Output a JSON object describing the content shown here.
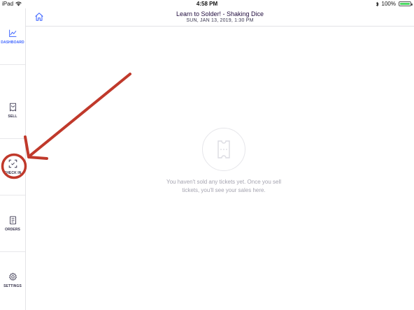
{
  "status_bar": {
    "device": "iPad",
    "time": "4:58 PM",
    "battery": "100%",
    "battery_level": 1.0
  },
  "header": {
    "title": "Learn to Solder! - Shaking Dice",
    "subtitle": "SUN, JAN 13, 2019, 1:30 PM"
  },
  "sidebar": {
    "items": [
      {
        "label": "DASHBOARD",
        "icon": "chart-line-icon",
        "active": true
      },
      {
        "label": "SELL",
        "icon": "ticket-icon",
        "active": false
      },
      {
        "label": "CHECK IN",
        "icon": "scan-icon",
        "active": false
      },
      {
        "label": "ORDERS",
        "icon": "receipt-icon",
        "active": false
      },
      {
        "label": "SETTINGS",
        "icon": "gear-icon",
        "active": false
      }
    ]
  },
  "empty_state": {
    "icon": "ticket-outline-icon",
    "message": "You haven't sold any tickets yet. Once you sell tickets, you'll see your sales here."
  },
  "colors": {
    "accent": "#3d64ff",
    "annotation_red": "#c0392b",
    "battery_green": "#4cd964"
  }
}
